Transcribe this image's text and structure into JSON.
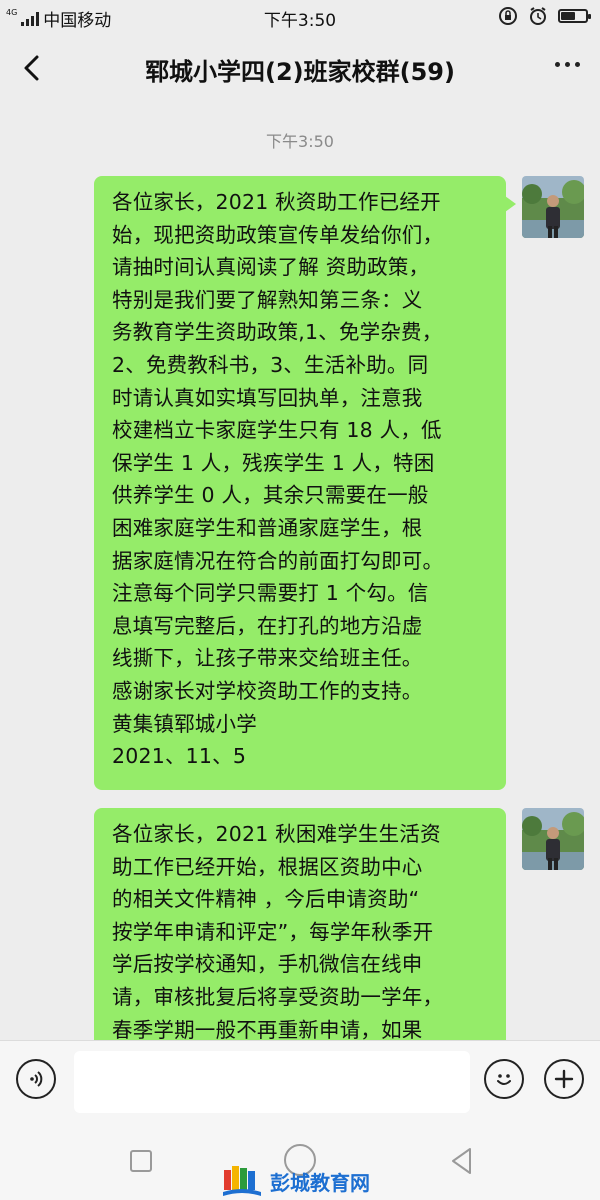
{
  "status_bar": {
    "network_type": "4G",
    "carrier": "中国移动",
    "time": "下午3:50",
    "battery_level": 0.6
  },
  "chat": {
    "title": "郓城小学四(2)班家校群(59)",
    "timestamp": "下午3:50",
    "messages": [
      {
        "text": "各位家长，2021 秋资助工作已经开\n始，现把资助政策宣传单发给你们，\n请抽时间认真阅读了解 资助政策，\n特别是我们要了解熟知第三条：义\n务教育学生资助政策,1、免学杂费，\n2、免费教科书，3、生活补助。同\n时请认真如实填写回执单，注意我\n校建档立卡家庭学生只有 18 人，低\n保学生 1 人，残疾学生 1 人，特困\n供养学生 0 人，其余只需要在一般\n困难家庭学生和普通家庭学生，根\n据家庭情况在符合的前面打勾即可。\n注意每个同学只需要打 1 个勾。信\n息填写完整后，在打孔的地方沿虚\n线撕下，让孩子带来交给班主任。\n感谢家长对学校资助工作的支持。\n黄集镇郓城小学\n2021、11、5"
      },
      {
        "text": "各位家长，2021 秋困难学生生活资\n助工作已经开始，根据区资助中心\n的相关文件精神 ，今后申请资助“\n按学年申请和评定”，每学年秋季开\n学后按学校通知，手机微信在线申\n请，审核批复后将享受资助一学年，\n春季学期一般不再重新申请，如果"
      }
    ]
  },
  "input": {
    "placeholder": ""
  },
  "watermark": {
    "text": "彭城教育网"
  },
  "icons": {
    "back": "chevron-left-icon",
    "more": "more-dots-icon",
    "voice": "voice-icon",
    "emoji": "emoji-icon",
    "plus": "plus-icon"
  },
  "colors": {
    "bubble": "#95ec69",
    "background": "#ededed",
    "watermark": "#1d6fd1"
  }
}
